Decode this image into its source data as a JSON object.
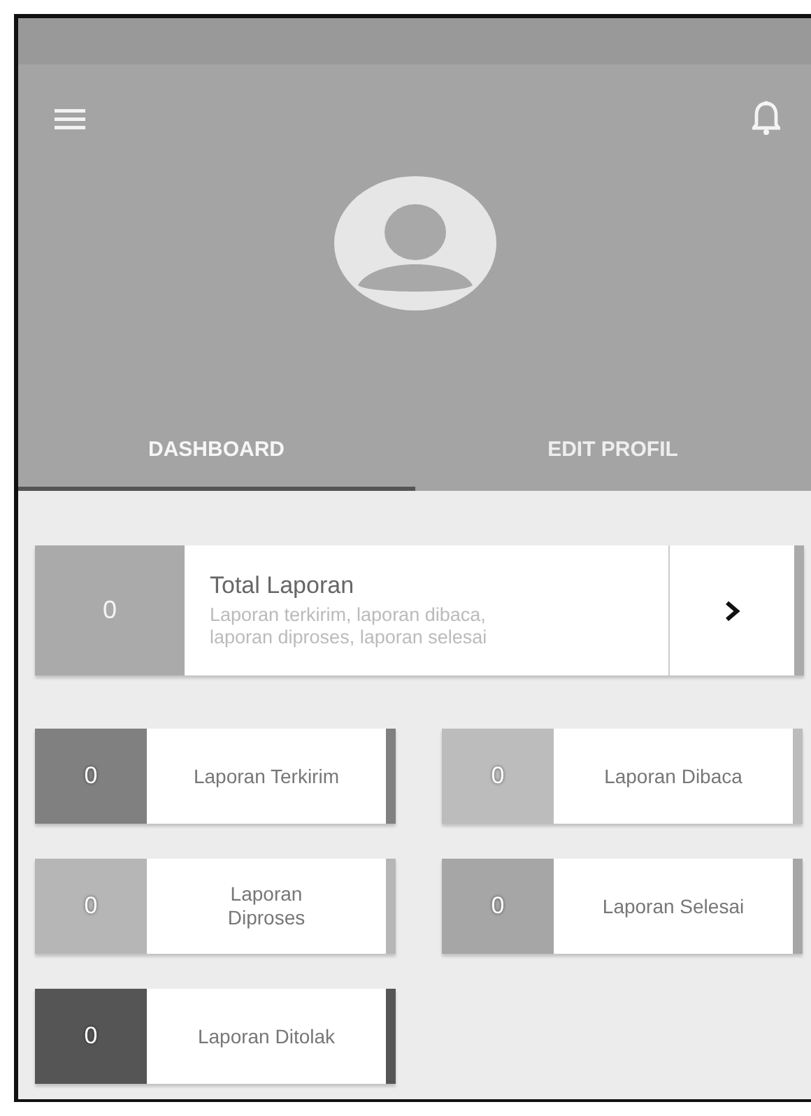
{
  "tabs": [
    {
      "label": "DASHBOARD",
      "selected": true
    },
    {
      "label": "EDIT PROFIL",
      "selected": false
    }
  ],
  "total": {
    "count": "0",
    "title": "Total Laporan",
    "description": "Laporan terkirim, laporan dibaca, laporan diproses, laporan selesai",
    "color": "#aaaaaa"
  },
  "cards": [
    {
      "count": "0",
      "label": "Laporan Terkirim",
      "color": "#808080"
    },
    {
      "count": "0",
      "label": "Laporan Dibaca",
      "color": "#bcbcbc"
    },
    {
      "count": "0",
      "label": "Laporan\nDiproses",
      "color": "#b6b6b6"
    },
    {
      "count": "0",
      "label": "Laporan Selesai",
      "color": "#a6a6a6"
    },
    {
      "count": "0",
      "label": "Laporan Ditolak",
      "color": "#555555"
    }
  ]
}
